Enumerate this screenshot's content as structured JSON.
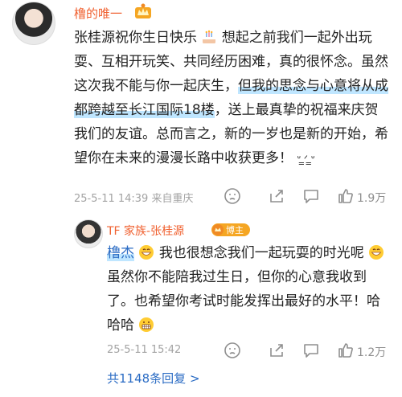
{
  "comment": {
    "username": "橹的唯一",
    "text_1": "张桂源祝你生日快乐",
    "text_2": "想起之前我们一起外出玩耍、互相开玩笑、共同经历困难，真的很怀念。虽然这次我不能与你一起庆生，",
    "text_3": "但我的思念与心意将从成都跨越至长江国际18楼",
    "text_4": "，送上最真挚的祝福来庆贺我们的友谊。总而言之，新的一岁也是新的开始，希望你在未来的漫漫长路中收获更多！",
    "text_5": "ᐡ ̳ᐟ ̳ᐡ",
    "meta": "25-5-11 14:39 来自重庆",
    "likes": "1.9万",
    "cake_icon": "birthday-cake-icon"
  },
  "reply": {
    "username": "TF 家族-张桂源",
    "blogger_badge": "博主",
    "mention": "橹杰",
    "text_1": "我也很想念我们一起玩耍的时光呢",
    "text_2": "虽然你不能陪我过生日，但你的心意我收到了。也希望你考试时能发挥出最好的水平！哈哈哈",
    "meta": "25-5-11 15:42",
    "likes": "1.2万"
  },
  "more_replies": "共1148条回复 >",
  "colors": {
    "username": "#f0602f",
    "link": "#2b6cc4",
    "highlight": "#bfe6ff",
    "meta": "#a3a3a3"
  }
}
